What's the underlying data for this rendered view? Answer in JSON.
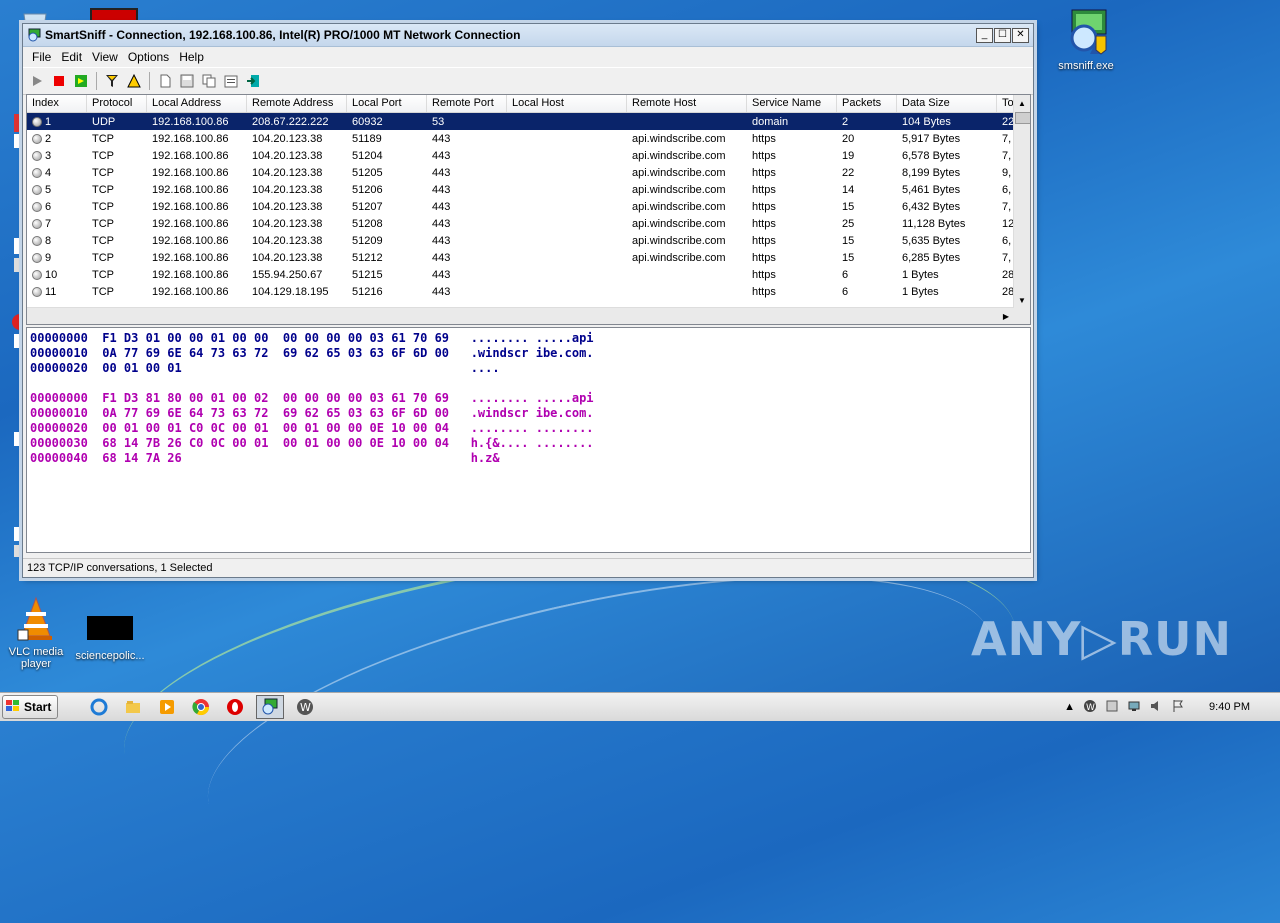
{
  "window": {
    "title": "SmartSniff  -  Connection, 192.168.100.86, Intel(R) PRO/1000 MT Network Connection",
    "menu": [
      "File",
      "Edit",
      "View",
      "Options",
      "Help"
    ]
  },
  "table": {
    "columns": [
      "Index",
      "Protocol",
      "Local Address",
      "Remote Address",
      "Local Port",
      "Remote Port",
      "Local Host",
      "Remote Host",
      "Service Name",
      "Packets",
      "Data Size",
      "To"
    ],
    "rows": [
      [
        "1",
        "UDP",
        "192.168.100.86",
        "208.67.222.222",
        "60932",
        "53",
        "",
        "",
        "domain",
        "2",
        "104 Bytes",
        "22"
      ],
      [
        "2",
        "TCP",
        "192.168.100.86",
        "104.20.123.38",
        "51189",
        "443",
        "",
        "api.windscribe.com",
        "https",
        "20",
        "5,917 Bytes",
        "7,"
      ],
      [
        "3",
        "TCP",
        "192.168.100.86",
        "104.20.123.38",
        "51204",
        "443",
        "",
        "api.windscribe.com",
        "https",
        "19",
        "6,578 Bytes",
        "7,"
      ],
      [
        "4",
        "TCP",
        "192.168.100.86",
        "104.20.123.38",
        "51205",
        "443",
        "",
        "api.windscribe.com",
        "https",
        "22",
        "8,199 Bytes",
        "9,"
      ],
      [
        "5",
        "TCP",
        "192.168.100.86",
        "104.20.123.38",
        "51206",
        "443",
        "",
        "api.windscribe.com",
        "https",
        "14",
        "5,461 Bytes",
        "6,"
      ],
      [
        "6",
        "TCP",
        "192.168.100.86",
        "104.20.123.38",
        "51207",
        "443",
        "",
        "api.windscribe.com",
        "https",
        "15",
        "6,432 Bytes",
        "7,"
      ],
      [
        "7",
        "TCP",
        "192.168.100.86",
        "104.20.123.38",
        "51208",
        "443",
        "",
        "api.windscribe.com",
        "https",
        "25",
        "11,128 Bytes",
        "12"
      ],
      [
        "8",
        "TCP",
        "192.168.100.86",
        "104.20.123.38",
        "51209",
        "443",
        "",
        "api.windscribe.com",
        "https",
        "15",
        "5,635 Bytes",
        "6,"
      ],
      [
        "9",
        "TCP",
        "192.168.100.86",
        "104.20.123.38",
        "51212",
        "443",
        "",
        "api.windscribe.com",
        "https",
        "15",
        "6,285 Bytes",
        "7,"
      ],
      [
        "10",
        "TCP",
        "192.168.100.86",
        "155.94.250.67",
        "51215",
        "443",
        "",
        "",
        "https",
        "6",
        "1 Bytes",
        "28"
      ],
      [
        "11",
        "TCP",
        "192.168.100.86",
        "104.129.18.195",
        "51216",
        "443",
        "",
        "",
        "https",
        "6",
        "1 Bytes",
        "28"
      ]
    ]
  },
  "hex": {
    "out1": [
      "00000000  F1 D3 01 00 00 01 00 00  00 00 00 00 03 61 70 69   ........ .....api",
      "00000010  0A 77 69 6E 64 73 63 72  69 62 65 03 63 6F 6D 00   .windscr ibe.com.",
      "00000020  00 01 00 01                                        ...."
    ],
    "in1": [
      "00000000  F1 D3 81 80 00 01 00 02  00 00 00 00 03 61 70 69   ........ .....api",
      "00000010  0A 77 69 6E 64 73 63 72  69 62 65 03 63 6F 6D 00   .windscr ibe.com.",
      "00000020  00 01 00 01 C0 0C 00 01  00 01 00 00 0E 10 00 04   ........ ........",
      "00000030  68 14 7B 26 C0 0C 00 01  00 01 00 00 0E 10 00 04   h.{&.... ........",
      "00000040  68 14 7A 26                                        h.z&"
    ]
  },
  "status": "123 TCP/IP conversations, 1 Selected",
  "desktop": {
    "icons": [
      {
        "label": "smsniff.exe"
      },
      {
        "label": "VLC media player"
      },
      {
        "label": "sciencepolic..."
      }
    ],
    "watermark": "ANY▷RUN"
  },
  "taskbar": {
    "start": "Start",
    "clock": "9:40 PM"
  },
  "colors": {
    "selection": "#0a246a",
    "hex_outgoing": "#00008b",
    "hex_incoming": "#b000b0"
  }
}
